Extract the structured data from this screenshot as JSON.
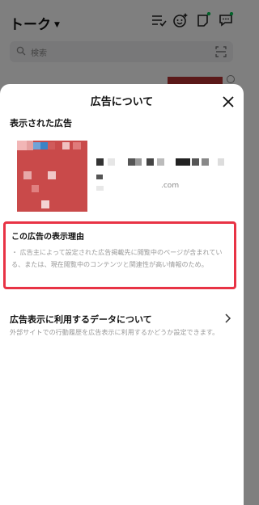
{
  "background": {
    "title": "トーク",
    "search_placeholder": "検索"
  },
  "sheet": {
    "title": "広告について",
    "displayed_ad_label": "表示された広告",
    "ad_domain": ".com",
    "reason": {
      "title": "この広告の表示理由",
      "text": "・ 広告主によって設定された広告掲載先に閲覧中のページが含まれている、または、現在閲覧中のコンテンツと関連性が高い情報のため。"
    },
    "data_usage": {
      "title": "広告表示に利用するデータについて",
      "description": "外部サイトでの行動履歴を広告表示に利用するかどうか設定できます。"
    }
  },
  "colors": {
    "highlight": "#e83345",
    "ad_red": "#c94a4a",
    "accent_green": "#06c755"
  }
}
